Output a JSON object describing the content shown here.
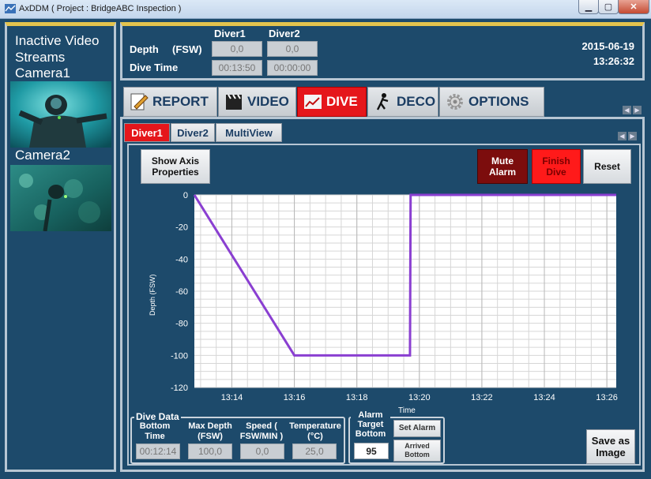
{
  "window": {
    "title": "AxDDM ( Project : BridgeABC Inspection )",
    "min_glyph": "▁",
    "max_glyph": "▢",
    "close_glyph": "✕"
  },
  "left_panel": {
    "title": "Inactive Video Streams",
    "camera1_label": "Camera1",
    "camera2_label": "Camera2"
  },
  "info": {
    "depth_label": "Depth",
    "depth_unit": "(FSW)",
    "dive_time_label": "Dive Time",
    "diver1_header": "Diver1",
    "diver2_header": "Diver2",
    "diver1_depth": "0,0",
    "diver2_depth": "0,0",
    "diver1_time": "00:13:50",
    "diver2_time": "00:00:00",
    "date": "2015-06-19",
    "time": "13:26:32"
  },
  "main_tabs": [
    {
      "label": "REPORT",
      "icon": "pencil-report-icon"
    },
    {
      "label": "VIDEO",
      "icon": "clapperboard-icon"
    },
    {
      "label": "DIVE",
      "icon": "dive-chart-icon"
    },
    {
      "label": "DECO",
      "icon": "diver-icon"
    },
    {
      "label": "OPTIONS",
      "icon": "gear-icon"
    }
  ],
  "sub_tabs": [
    "Diver1",
    "Diver2",
    "MultiView"
  ],
  "buttons": {
    "show_axis": "Show Axis Properties",
    "mute_alarm": "Mute Alarm",
    "finish_dive": "Finish Dive",
    "reset": "Reset",
    "save_image": "Save as Image",
    "set_alarm": "Set Alarm",
    "arrived_bottom": "Arrived Bottom"
  },
  "chart_data": {
    "type": "line",
    "xlabel": "Time",
    "ylabel": "Depth    (FSW)",
    "ylim": [
      -120,
      0
    ],
    "yticks": [
      "0",
      "-20",
      "-40",
      "-60",
      "-80",
      "-100",
      "-120"
    ],
    "xticks": [
      "13:14",
      "13:16",
      "13:18",
      "13:20",
      "13:22",
      "13:24",
      "13:26"
    ],
    "xlim_minutes": [
      12.8,
      26.3
    ],
    "grid": true,
    "line_color": "#8a3fd1",
    "series": [
      {
        "x_minutes": [
          12.8,
          16.0,
          19.7,
          19.72,
          26.3
        ],
        "values": [
          0,
          -100,
          -100,
          0,
          0
        ]
      }
    ]
  },
  "dive_data": {
    "title": "Dive Data",
    "fields": [
      {
        "label": "Bottom Time",
        "value": "00:12:14"
      },
      {
        "label": "Max Depth (FSW)",
        "value": "100,0"
      },
      {
        "label": "Speed ( FSW/MIN )",
        "value": "0,0"
      },
      {
        "label": "Temperature (°C)",
        "value": "25,0"
      }
    ]
  },
  "alarm": {
    "title": "Alarm Target Bottom",
    "value": "95"
  },
  "colors": {
    "background": "#1d4a6b",
    "accent_red": "#e5161b",
    "frame_gold": "#e3c34d"
  }
}
